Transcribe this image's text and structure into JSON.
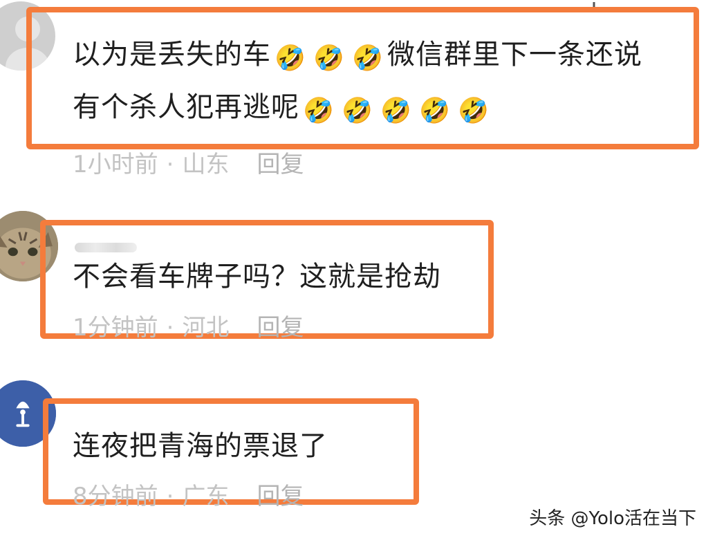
{
  "colors": {
    "highlight": "#f47c3c",
    "meta_text": "#c3c3c3"
  },
  "comments": [
    {
      "line1": "以为是丢失的车",
      "line1_tail": "微信群里下一条还说",
      "line2": "有个杀人犯再逃呢",
      "emoji_icon": "laughing-crying-emoji",
      "emoji_char": "🤣",
      "time": "1小时前",
      "location": "山东",
      "reply": "回复"
    },
    {
      "text": "不会看车牌子吗？这就是抢劫",
      "time": "1分钟前",
      "location": "河北",
      "reply": "回复"
    },
    {
      "text": "连夜把青海的票退了",
      "time": "8分钟前",
      "location": "广东",
      "reply": "回复"
    }
  ],
  "meta_separator": "·",
  "watermark": "头条 @Yolo活在当下"
}
